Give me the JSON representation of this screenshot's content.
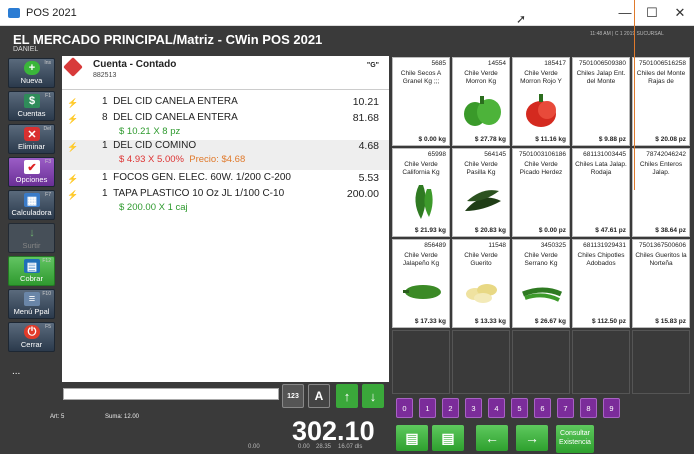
{
  "window": {
    "title": "POS 2021",
    "minimize": "—",
    "maximize": "☐",
    "close": "✕"
  },
  "header": {
    "store": "EL MERCADO PRINCIPAL/Matriz - CWin POS 2021",
    "user": "DANIEL",
    "info": "11:48 AM  |  C 1 2019 SUCURSAL"
  },
  "sidebar": [
    {
      "label": "Nueva",
      "key": "Ins",
      "icon": "plus-icon"
    },
    {
      "label": "Cuentas",
      "key": "F1",
      "icon": "cash-icon"
    },
    {
      "label": "Eliminar",
      "key": "Del",
      "icon": "close-icon"
    },
    {
      "label": "Opciones",
      "key": "F3",
      "icon": "checklist-icon"
    },
    {
      "label": "Calculadora",
      "key": "F7",
      "icon": "calculator-icon"
    },
    {
      "label": "Surtir",
      "key": "",
      "icon": "down-arrow-icon"
    },
    {
      "label": "Cobrar",
      "key": "F12",
      "icon": "register-icon"
    },
    {
      "label": "Menú Ppal",
      "key": "F10",
      "icon": "menu-icon"
    },
    {
      "label": "Cerrar",
      "key": "F5",
      "icon": "power-icon"
    }
  ],
  "sidebar_extra": "...",
  "ticket": {
    "account": "Cuenta - Contado",
    "account_number": "882513",
    "account_flag": "\"G\"",
    "items": [
      {
        "qty": "1",
        "desc": "DEL CID CANELA ENTERA",
        "amount": "10.21",
        "sub": "",
        "sub2": ""
      },
      {
        "qty": "8",
        "desc": "DEL CID CANELA ENTERA",
        "amount": "81.68",
        "sub": "$ 10.21 X 8 pz",
        "sub2": ""
      },
      {
        "qty": "1",
        "desc": "DEL CID COMINO",
        "amount": "4.68",
        "sub": "$ 4.93 X 5.00%",
        "sub2": "Precio: $4.68"
      },
      {
        "qty": "1",
        "desc": "FOCOS GEN. ELEC. 60W. 1/200 C-200",
        "amount": "5.53",
        "sub": "",
        "sub2": ""
      },
      {
        "qty": "1",
        "desc": "TAPA  PLASTICO 10 Oz JL 1/100 C-10",
        "amount": "200.00",
        "sub": "$ 200.00 X 1 caj",
        "sub2": ""
      }
    ]
  },
  "keypad": {
    "numeric": "123",
    "alpha": "A"
  },
  "footer": {
    "art": "Art: 5",
    "suma": "Suma: 12.00",
    "total": "302.10",
    "sub_a": "0.00",
    "sub_b": "0.00",
    "sub_c": "28.35",
    "sub_d": "16.07 dls"
  },
  "products": [
    {
      "code": "5685",
      "name": "Chile Secos A Granel Kg ;;;",
      "price": "$ 0.00 kg",
      "img": "none"
    },
    {
      "code": "14554",
      "name": "Chile Verde Morron Kg",
      "price": "$ 27.78 kg",
      "img": "green-pepper"
    },
    {
      "code": "185417",
      "name": "Chile Verde Morron Rojo Y",
      "price": "$ 11.16 kg",
      "img": "red-pepper"
    },
    {
      "code": "7501006509380",
      "name": "Chiles Jalap Ent. del Monte",
      "price": "$ 9.88 pz",
      "img": "none"
    },
    {
      "code": "7501006516258",
      "name": "Chiles del Monte Rajas de",
      "price": "$ 20.08 pz",
      "img": "none"
    },
    {
      "code": "65998",
      "name": "Chile Verde California Kg",
      "price": "$ 21.93 kg",
      "img": "long-green"
    },
    {
      "code": "564145",
      "name": "Chile Verde Pasilla Kg",
      "price": "$ 20.83 kg",
      "img": "dark-green"
    },
    {
      "code": "7501003106186",
      "name": "Chile Verde Picado Herdez",
      "price": "$ 0.00 pz",
      "img": "none"
    },
    {
      "code": "681131003445",
      "name": "Chiles Lata Jalap. Rodaja",
      "price": "$ 47.61 pz",
      "img": "none"
    },
    {
      "code": "78742046242",
      "name": "Chiles Enteros Jalap.",
      "price": "$ 38.64 pz",
      "img": "none"
    },
    {
      "code": "856489",
      "name": "Chile Verde Jalapeño Kg",
      "price": "$ 17.33 kg",
      "img": "jalapeno"
    },
    {
      "code": "11548",
      "name": "Chile Verde Guerito",
      "price": "$ 13.33 kg",
      "img": "yellow"
    },
    {
      "code": "3450325",
      "name": "Chile Verde Serrano Kg",
      "price": "$ 26.67 kg",
      "img": "serrano"
    },
    {
      "code": "681131929431",
      "name": "Chiles Chipotles Adobados",
      "price": "$ 112.50 pz",
      "img": "none"
    },
    {
      "code": "7501367500606",
      "name": "Chiles Gueritos la Norteña",
      "price": "$ 15.83 pz",
      "img": "none"
    }
  ],
  "numkeys": [
    "0",
    "1",
    "2",
    "3",
    "4",
    "5",
    "6",
    "7",
    "8",
    "9"
  ],
  "bottom_buttons": {
    "consult": "Consultar Existencia"
  }
}
